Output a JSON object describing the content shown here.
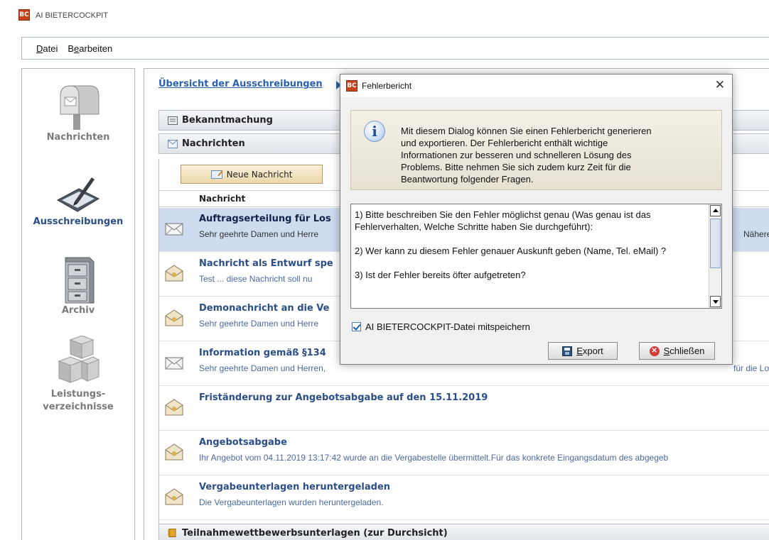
{
  "app": {
    "title": "AI BIETERCOCKPIT",
    "logo_text": "BC"
  },
  "menu": [
    {
      "label": "Datei",
      "mnemonic": "D",
      "rest": "atei"
    },
    {
      "label": "Bearbeiten",
      "pre": "B",
      "mnemonic": "e",
      "rest": "arbeiten"
    }
  ],
  "nav": {
    "items": [
      {
        "label": "Nachrichten",
        "icon": "mailbox-icon",
        "active": false
      },
      {
        "label": "Ausschreibungen",
        "icon": "signing-tablet-icon",
        "active": true
      },
      {
        "label": "Archiv",
        "icon": "file-cabinet-icon",
        "active": false
      },
      {
        "label_line1": "Leistungs-",
        "label_line2": "verzeichnisse",
        "icon": "boxes-icon",
        "active": false
      }
    ]
  },
  "main": {
    "breadcrumb": "Übersicht der Ausschreibungen",
    "sections": {
      "bekanntmachung": "Bekanntmachung",
      "nachrichten": "Nachrichten",
      "teilnahme": "Teilnahmewettbewerbsunterlagen (zur Durchsicht)"
    },
    "new_message_button": "Neue Nachricht",
    "column_header": "Nachricht",
    "messages": [
      {
        "title": "Auftragserteilung für Los",
        "sub": "Sehr geehrte Damen und Herre",
        "sub_right": "Näheres",
        "selected": true,
        "icon": "envelope-open-icon"
      },
      {
        "title": "Nachricht als Entwurf spe",
        "sub": "Test ... diese Nachricht soll nu",
        "selected": false,
        "icon": "envelope-sealed-icon"
      },
      {
        "title": "Demonachricht an die Ve",
        "sub": "Sehr geehrte Damen und Herre",
        "selected": false,
        "icon": "envelope-sealed-icon"
      },
      {
        "title": "Information gemäß §134",
        "sub": "Sehr geehrte Damen und Herren,",
        "sub_right": "für die Lo",
        "selected": false,
        "icon": "envelope-open-icon"
      },
      {
        "title": "Friständerung zur Angebotsabgabe auf den 15.11.2019",
        "sub": "",
        "selected": false,
        "icon": "envelope-sealed-icon"
      },
      {
        "title": "Angebotsabgabe",
        "sub": "Ihr Angebot vom 04.11.2019 13:17:42 wurde an die Vergabestelle übermittelt.Für das konkrete Eingangsdatum des abgegeb",
        "selected": false,
        "icon": "envelope-sealed-icon"
      },
      {
        "title": "Vergabeunterlagen heruntergeladen",
        "sub": "Die Vergabeunterlagen wurden heruntergeladen.",
        "selected": false,
        "icon": "envelope-sealed-icon"
      }
    ]
  },
  "dialog": {
    "title": "Fehlerbericht",
    "logo_text": "BC",
    "close_glyph": "✕",
    "info_text": "Mit diesem Dialog können Sie einen Fehlerbericht generieren\nund exportieren. Der Fehlerbericht enthält wichtige\nInformationen zur besseren und schnelleren Lösung des\nProblems. Bitte nehmen Sie sich zudem kurz Zeit für die\nBeantwortung folgender Fragen.",
    "textarea_value": "1) Bitte beschreiben Sie den Fehler möglichst genau (Was genau ist das Fehlerverhalten, Welche Schritte haben Sie durchgeführt):\n\n2) Wer kann zu diesem Fehler genauer Auskunft geben (Name, Tel. eMail) ?\n\n3) Ist der Fehler bereits öfter aufgetreten?",
    "checkbox_label": "AI BIETERCOCKPIT-Datei mitspeichern",
    "checkbox_checked": true,
    "export_label": "Export",
    "export_mnemonic": "E",
    "export_rest": "xport",
    "close_label": "Schließen",
    "close_mnemonic": "S",
    "close_rest": "chließen"
  }
}
